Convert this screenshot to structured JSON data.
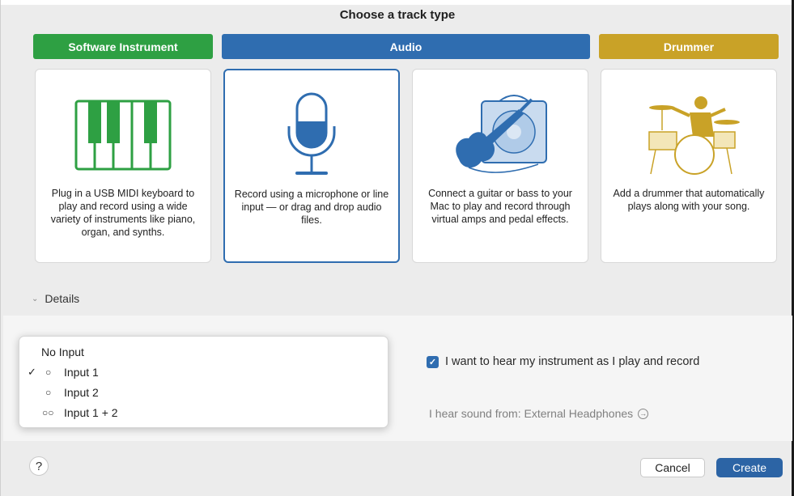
{
  "dialog": {
    "title": "Choose a track type"
  },
  "track_types": [
    {
      "label": "Software Instrument",
      "color": "#2ea043",
      "description": "Plug in a USB MIDI keyboard to play and record using a wide variety of instruments like piano, organ, and synths.",
      "icon": "piano-keys-icon"
    },
    {
      "label": "Audio",
      "color": "#2f6db0",
      "description": "Record using a microphone or line input — or drag and drop audio files.",
      "icon": "microphone-icon"
    },
    {
      "label": "",
      "color": "#2f6db0",
      "description": "Connect a guitar or bass to your Mac to play and record through virtual amps and pedal effects.",
      "icon": "guitar-amp-icon"
    },
    {
      "label": "Drummer",
      "color": "#c9a227",
      "description": "Add a drummer that automatically plays along with your song.",
      "icon": "drummer-icon"
    }
  ],
  "selected_type": "Audio",
  "details": {
    "label": "Details",
    "input_menu": {
      "items": [
        {
          "label": "No Input",
          "checked": false,
          "icon": ""
        },
        {
          "label": "Input 1",
          "checked": true,
          "icon": "mono-input-icon"
        },
        {
          "label": "Input 2",
          "checked": false,
          "icon": "mono-input-icon"
        },
        {
          "label": "Input 1 + 2",
          "checked": false,
          "icon": "stereo-input-icon"
        }
      ]
    },
    "monitor_checkbox": {
      "label": "I want to hear my instrument as I play and record",
      "checked": true
    },
    "output": {
      "label": "I hear sound from: External Headphones"
    }
  },
  "footer": {
    "help": "?",
    "cancel": "Cancel",
    "create": "Create"
  },
  "colors": {
    "accent": "#2f6db0",
    "software_instrument": "#2ea043",
    "drummer": "#c9a227"
  }
}
